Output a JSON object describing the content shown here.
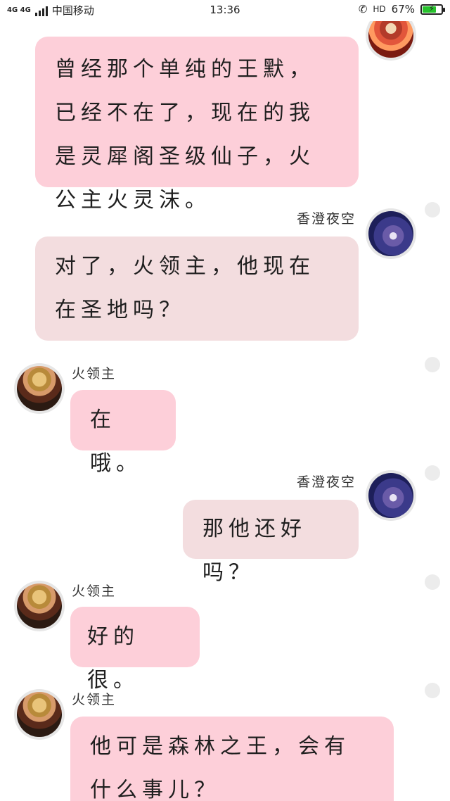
{
  "status_bar": {
    "network": "4G 4G",
    "carrier": "中国移动",
    "time": "13:36",
    "hd": "HD",
    "battery": "67%",
    "battery_level": 0.67
  },
  "messages": [
    {
      "side": "right",
      "sender": "",
      "avatar": "avatar-fire",
      "bubble_color": "#fdcfd9",
      "text": "曾经那个单纯的王默，已经不在了，现在的我是灵犀阁圣级仙子，火公主火灵沫。"
    },
    {
      "side": "right",
      "sender": "香澄夜空",
      "avatar": "avatar-night",
      "bubble_color": "#f3dddf",
      "text": "对了，火领主，他现在在圣地吗？"
    },
    {
      "side": "left",
      "sender": "火领主",
      "avatar": "avatar-lord",
      "bubble_color": "#fdcfd9",
      "text": "在哦。"
    },
    {
      "side": "right",
      "sender": "香澄夜空",
      "avatar": "avatar-night",
      "bubble_color": "#f3dddf",
      "text": "那他还好吗？"
    },
    {
      "side": "left",
      "sender": "火领主",
      "avatar": "avatar-lord",
      "bubble_color": "#fdcfd9",
      "text": "好的很。"
    },
    {
      "side": "left",
      "sender": "火领主",
      "avatar": "avatar-lord",
      "bubble_color": "#fdcfd9",
      "text": "他可是森林之王，会有什么事儿？"
    }
  ],
  "colors": {
    "bubble_pink": "#fdcfd9",
    "bubble_grey": "#f3dddf",
    "status_dot": "#ececec",
    "battery_green": "#27c22d"
  }
}
